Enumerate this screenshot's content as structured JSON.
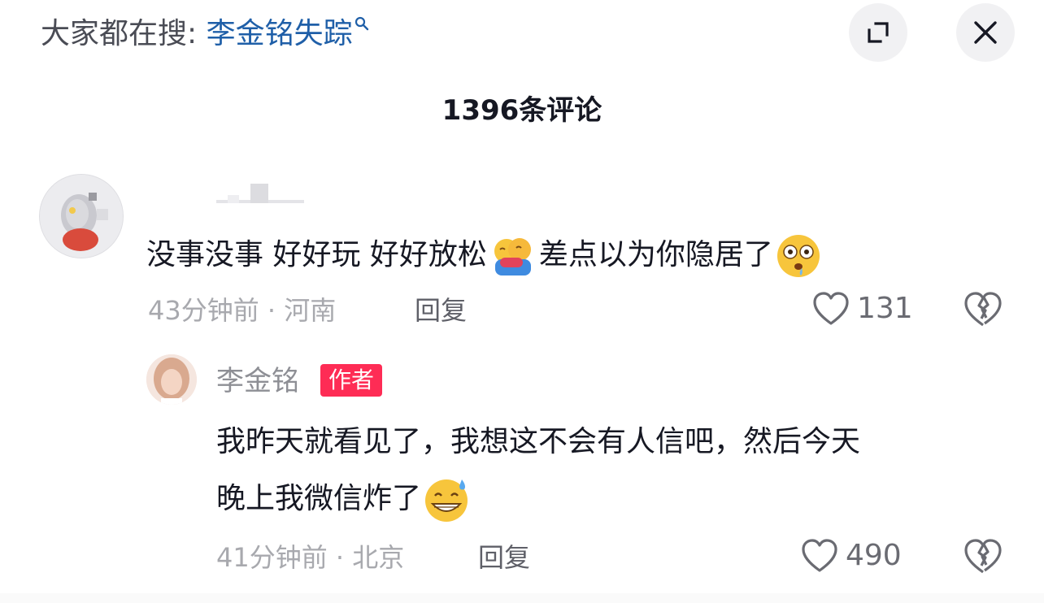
{
  "header": {
    "search_prefix": "大家都在搜: ",
    "search_keyword": "李金铭失踪"
  },
  "comment_count": "1396条评论",
  "comments": [
    {
      "text_before": "没事没事 好好玩 好好放松",
      "emoji_1": "hug-emoji",
      "text_after": "差点以为你隐居了",
      "emoji_2": "flushed-drool-emoji",
      "meta": "43分钟前 · 河南",
      "reply_label": "回复",
      "likes": "131"
    }
  ],
  "reply": {
    "author": "李金铭",
    "badge": "作者",
    "line1": "我昨天就看见了，我想这不会有人信吧，然后今天",
    "line2": "晚上我微信炸了",
    "emoji": "grin-sweat-emoji",
    "meta": "41分钟前 · 北京",
    "reply_label": "回复",
    "likes": "490"
  },
  "colors": {
    "keyword": "#1f5fa8",
    "badge": "#fe2c55",
    "meta": "#a8a9ae"
  }
}
